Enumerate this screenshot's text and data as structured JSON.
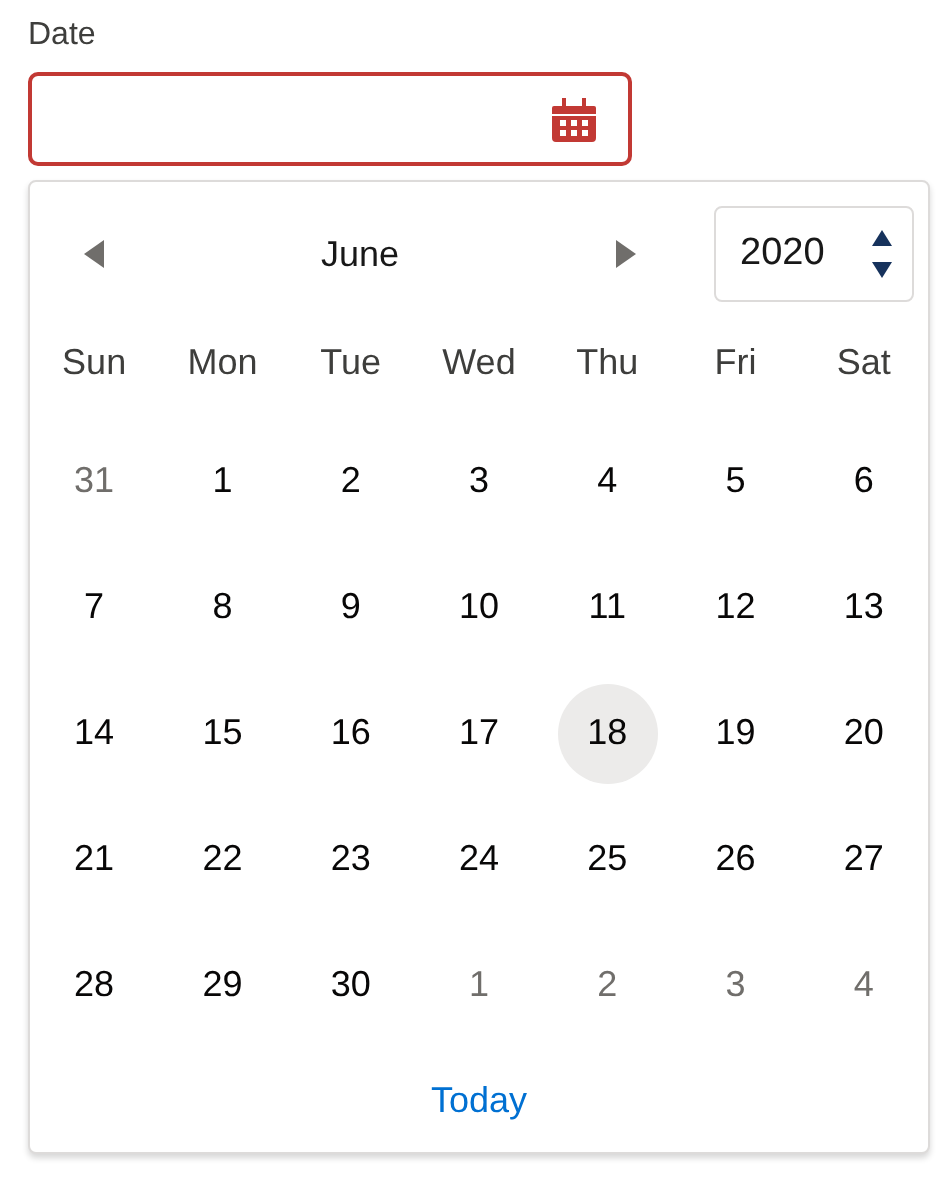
{
  "field": {
    "label": "Date",
    "invalid": true
  },
  "calendar": {
    "month": "June",
    "year": "2020",
    "weekdays": [
      "Sun",
      "Mon",
      "Tue",
      "Wed",
      "Thu",
      "Fri",
      "Sat"
    ],
    "weeks": [
      [
        {
          "day": "31",
          "outside_month": true,
          "selected": false
        },
        {
          "day": "1",
          "outside_month": false,
          "selected": false
        },
        {
          "day": "2",
          "outside_month": false,
          "selected": false
        },
        {
          "day": "3",
          "outside_month": false,
          "selected": false
        },
        {
          "day": "4",
          "outside_month": false,
          "selected": false
        },
        {
          "day": "5",
          "outside_month": false,
          "selected": false
        },
        {
          "day": "6",
          "outside_month": false,
          "selected": false
        }
      ],
      [
        {
          "day": "7",
          "outside_month": false,
          "selected": false
        },
        {
          "day": "8",
          "outside_month": false,
          "selected": false
        },
        {
          "day": "9",
          "outside_month": false,
          "selected": false
        },
        {
          "day": "10",
          "outside_month": false,
          "selected": false
        },
        {
          "day": "11",
          "outside_month": false,
          "selected": false
        },
        {
          "day": "12",
          "outside_month": false,
          "selected": false
        },
        {
          "day": "13",
          "outside_month": false,
          "selected": false
        }
      ],
      [
        {
          "day": "14",
          "outside_month": false,
          "selected": false
        },
        {
          "day": "15",
          "outside_month": false,
          "selected": false
        },
        {
          "day": "16",
          "outside_month": false,
          "selected": false
        },
        {
          "day": "17",
          "outside_month": false,
          "selected": false
        },
        {
          "day": "18",
          "outside_month": false,
          "selected": true
        },
        {
          "day": "19",
          "outside_month": false,
          "selected": false
        },
        {
          "day": "20",
          "outside_month": false,
          "selected": false
        }
      ],
      [
        {
          "day": "21",
          "outside_month": false,
          "selected": false
        },
        {
          "day": "22",
          "outside_month": false,
          "selected": false
        },
        {
          "day": "23",
          "outside_month": false,
          "selected": false
        },
        {
          "day": "24",
          "outside_month": false,
          "selected": false
        },
        {
          "day": "25",
          "outside_month": false,
          "selected": false
        },
        {
          "day": "26",
          "outside_month": false,
          "selected": false
        },
        {
          "day": "27",
          "outside_month": false,
          "selected": false
        }
      ],
      [
        {
          "day": "28",
          "outside_month": false,
          "selected": false
        },
        {
          "day": "29",
          "outside_month": false,
          "selected": false
        },
        {
          "day": "30",
          "outside_month": false,
          "selected": false
        },
        {
          "day": "1",
          "outside_month": true,
          "selected": false
        },
        {
          "day": "2",
          "outside_month": true,
          "selected": false
        },
        {
          "day": "3",
          "outside_month": true,
          "selected": false
        },
        {
          "day": "4",
          "outside_month": true,
          "selected": false
        }
      ]
    ],
    "today_link": "Today"
  }
}
